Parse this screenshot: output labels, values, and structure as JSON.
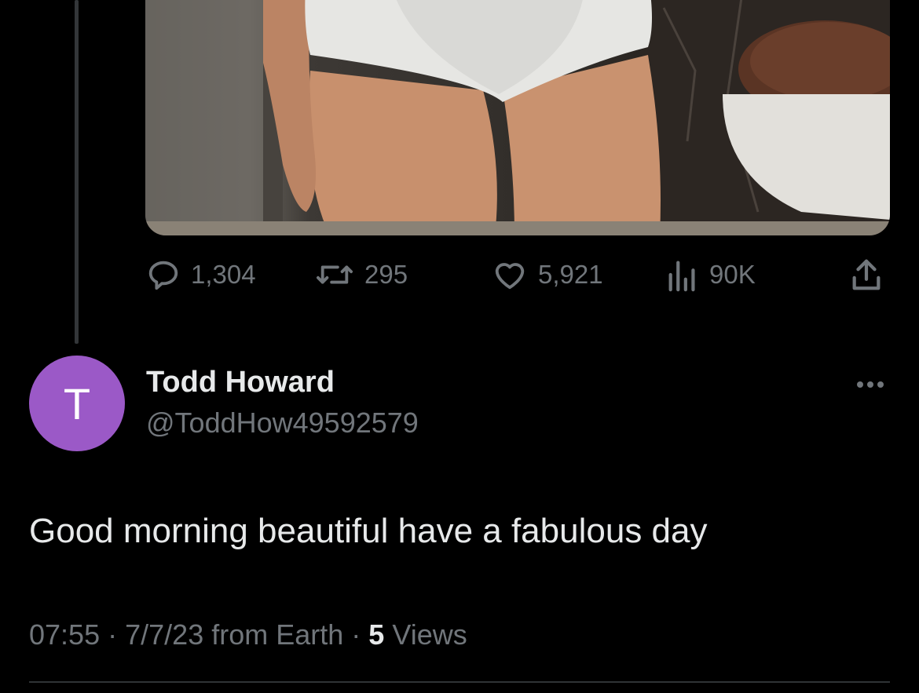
{
  "colors": {
    "background": "#000000",
    "primary_text": "#e7e9ea",
    "secondary_text": "#71767b",
    "avatar_bg": "#9b59c7",
    "thread_line": "#333639"
  },
  "media": {
    "kind": "photo",
    "icon": "photo-media"
  },
  "actions": {
    "reply": {
      "icon": "reply-bubble-icon",
      "count": "1,304"
    },
    "repost": {
      "icon": "repost-icon",
      "count": "295"
    },
    "like": {
      "icon": "heart-icon",
      "count": "5,921"
    },
    "views": {
      "icon": "analytics-bars-icon",
      "count": "90K"
    },
    "share": {
      "icon": "share-upload-icon"
    }
  },
  "reply_tweet": {
    "avatar_letter": "T",
    "display_name": "Todd Howard",
    "handle": "@ToddHow49592579",
    "more_icon": "more-dots-icon",
    "text": "Good morning beautiful have a fabulous day",
    "time": "07:55",
    "separator": "·",
    "date_source": "7/7/23 from Earth",
    "views_count": "5",
    "views_label": "Views"
  }
}
